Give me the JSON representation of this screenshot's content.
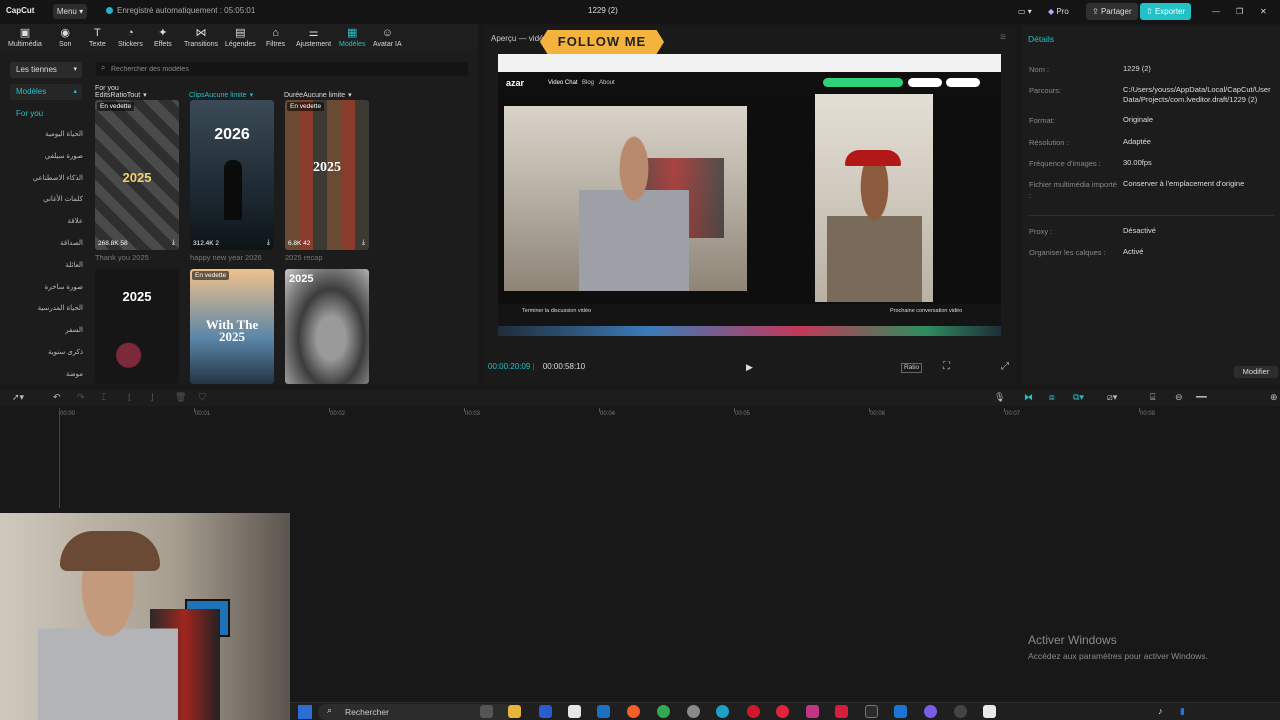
{
  "titlebar": {
    "logo": "CapCut",
    "menu_label": "Menu",
    "autosave_text": "Enregistré automatiquement : 05:05:01",
    "project_name": "1229 (2)",
    "pro_label": "Pro",
    "share_label": "Partager",
    "export_label": "Exporter"
  },
  "toolbar": {
    "tools": [
      {
        "label": "Multimédia",
        "icon": "media-icon"
      },
      {
        "label": "Son",
        "icon": "audio-icon"
      },
      {
        "label": "Texte",
        "icon": "text-icon"
      },
      {
        "label": "Stickers",
        "icon": "sticker-icon"
      },
      {
        "label": "Effets",
        "icon": "effects-icon"
      },
      {
        "label": "Transitions",
        "icon": "transition-icon"
      },
      {
        "label": "Légendes",
        "icon": "captions-icon"
      },
      {
        "label": "Filtres",
        "icon": "filters-icon"
      },
      {
        "label": "Ajustement",
        "icon": "adjust-icon"
      },
      {
        "label": "Modèles",
        "icon": "templates-icon"
      },
      {
        "label": "Avatar IA",
        "icon": "avatar-icon"
      }
    ],
    "active_index": 9
  },
  "left_panel": {
    "trends_dropdown": "Les tiennes",
    "models_dropdown": "Modèles",
    "foryou_label": "For you",
    "categories": [
      "الحياة اليومية",
      "صورة سيلفي",
      "الذكاء الاصطناعي",
      "كلمات الأغاني",
      "علاقة",
      "الصداقة",
      "العائلة",
      "صورة ساخرة",
      "الحياة المدرسية",
      "السفر",
      "ذكرى سنوية",
      "موضة"
    ],
    "search_placeholder": "Rechercher des modèles",
    "filter_foryou": "For you",
    "filters": [
      {
        "label": "EditsRatioTout"
      },
      {
        "label": "ClipsAucune limite"
      },
      {
        "label": "DuréeAucune limite"
      }
    ],
    "cards": [
      {
        "tag": "En vedette",
        "year": "2025",
        "stats": "268.8K  58",
        "title": "Thank you 2025"
      },
      {
        "tag": "",
        "year": "2026",
        "stats": "312.4K  2",
        "title": "happy new year 2026"
      },
      {
        "tag": "En vedette",
        "year": "2025",
        "stats": "6.8K  42",
        "title": "2025 recap"
      },
      {
        "tag": "",
        "year": "2025",
        "stats": "",
        "title": ""
      },
      {
        "tag": "En vedette",
        "year": "With The 2025",
        "stats": "",
        "title": ""
      },
      {
        "tag": "",
        "year": "2025",
        "stats": "",
        "title": ""
      }
    ]
  },
  "preview": {
    "title": "Aperçu — vidéo",
    "follow_banner": "FOLLOW ME",
    "azar_logo": "azar",
    "azar_nav": [
      "Video Chat",
      "Blog",
      "About"
    ],
    "azar_bottom_left": "Terminer la discussion vidéo",
    "azar_bottom_right": "Prochaine conversation vidéo",
    "time_current": "00:00:20:09",
    "time_total": "00:00:58:10",
    "ratio_label": "Ratio"
  },
  "details": {
    "header": "Détails",
    "rows": [
      {
        "key": "Nom :",
        "value": "1229 (2)"
      },
      {
        "key": "Parcours:",
        "value": "C:/Users/youss/AppData/Local/CapCut/User Data/Projects/com.lveditor.draft/1229 (2)"
      },
      {
        "key": "Format:",
        "value": "Originale"
      },
      {
        "key": "Résolution :",
        "value": "Adaptée"
      },
      {
        "key": "Fréquence d'images :",
        "value": "30.00fps"
      },
      {
        "key": "Fichier multimédia importé :",
        "value": "Conserver à l'emplacement d'origine"
      },
      {
        "key": "Proxy :",
        "value": "Désactivé"
      },
      {
        "key": "Organiser les calques :",
        "value": "Activé"
      }
    ],
    "modify_label": "Modifier"
  },
  "timeline": {
    "ticks": [
      "00:00",
      "00:01",
      "00:02",
      "00:03",
      "00:04",
      "00:05",
      "00:06",
      "00:07",
      "00:08"
    ]
  },
  "watermark": {
    "line1": "Activer Windows",
    "line2": "Accédez aux paramètres pour activer Windows."
  },
  "taskbar": {
    "search_label": "Rechercher"
  },
  "colors": {
    "accent": "#22c1c8",
    "banner": "#f4b33c"
  }
}
